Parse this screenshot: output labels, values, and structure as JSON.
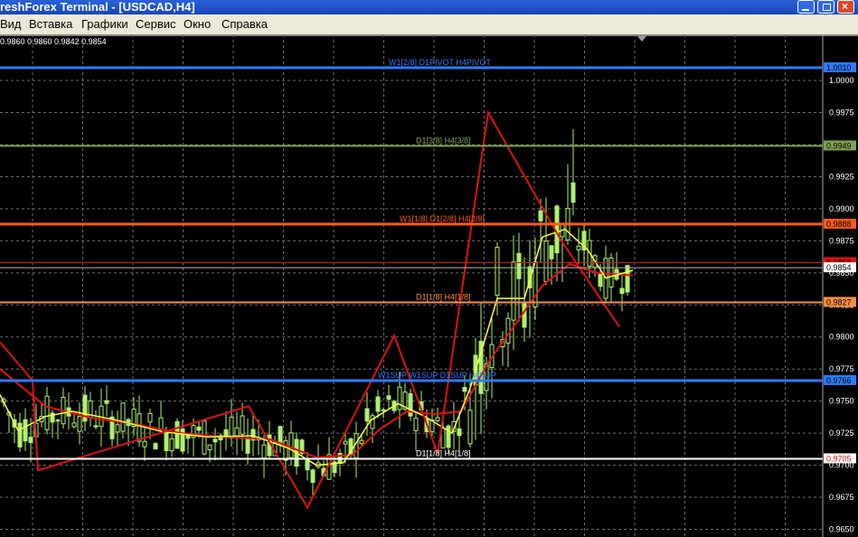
{
  "window": {
    "title": "reshForex Terminal - [USDCAD,H4]"
  },
  "menu": [
    "Вид",
    "Вставка",
    "Графики",
    "Сервис",
    "Окно",
    "Справка"
  ],
  "ohlc_text": "0.9860 0.9860 0.9842 0.9854",
  "colors": {
    "bg": "#000000",
    "grid": "#6b6b6b",
    "blue": "#2b7bff",
    "green": "#7fa050",
    "orange": "#ff5a1a",
    "red": "#e01010",
    "candle": "#b0f070",
    "yellow": "#ffff44"
  },
  "chart_data": {
    "type": "candlestick",
    "symbol": "USDCAD",
    "timeframe": "H4",
    "ylim": [
      0.9644,
      1.0036
    ],
    "price_ticks": [
      "1.0000",
      "0.9975",
      "0.9950",
      "0.9925",
      "0.9900",
      "0.9875",
      "0.9850",
      "0.9825",
      "0.9800",
      "0.9775",
      "0.9750",
      "0.9725",
      "0.9700",
      "0.9675",
      "0.9650"
    ],
    "current_price": "0.9854",
    "levels": [
      {
        "price": 1.001,
        "label": "W1[2/8] D1PIVOT H4PIVOT",
        "tag": "1.0010",
        "color": "#2b7bff",
        "width": 3
      },
      {
        "price": 0.9949,
        "label": "D1[3/8] H4[3/8]",
        "tag": "0.9949",
        "color": "#7fa050",
        "width": 2
      },
      {
        "price": 0.9888,
        "label": "W1[1/8] D1[2/8] H4[2/8]",
        "tag": "0.9888",
        "color": "#ff5a1a",
        "width": 3
      },
      {
        "price": 0.9858,
        "label": "",
        "tag": "0.9858",
        "color": "#e01010",
        "width": 1
      },
      {
        "price": 0.9827,
        "label": "D1[1/8] H4[1/8]",
        "tag": "0.9827",
        "color": "#ff8c40",
        "width": 2
      },
      {
        "price": 0.9766,
        "label": "W1SUP W1SUP D1SUP H4SUP",
        "tag": "0.9766",
        "color": "#2b7bff",
        "width": 3
      },
      {
        "price": 0.9705,
        "label": "D1[1/8] H4[1/8]",
        "tag": "0.9705",
        "color": "#ffffff",
        "width": 2
      }
    ],
    "zigzag": [
      [
        0,
        0.9796
      ],
      [
        36,
        0.9766
      ],
      [
        42,
        0.9696
      ],
      [
        275,
        0.9746
      ],
      [
        340,
        0.9667
      ],
      [
        436,
        0.9801
      ],
      [
        484,
        0.9709
      ],
      [
        540,
        0.9975
      ],
      [
        620,
        0.9876
      ],
      [
        685,
        0.9808
      ]
    ],
    "ma_yellow": [
      [
        0,
        0.9755
      ],
      [
        20,
        0.9727
      ],
      [
        50,
        0.9738
      ],
      [
        80,
        0.9742
      ],
      [
        130,
        0.9735
      ],
      [
        180,
        0.9726
      ],
      [
        230,
        0.9722
      ],
      [
        280,
        0.9723
      ],
      [
        320,
        0.9713
      ],
      [
        350,
        0.97
      ],
      [
        380,
        0.9702
      ],
      [
        410,
        0.9735
      ],
      [
        440,
        0.9748
      ],
      [
        470,
        0.9738
      ],
      [
        500,
        0.9725
      ],
      [
        520,
        0.976
      ],
      [
        550,
        0.983
      ],
      [
        580,
        0.983
      ],
      [
        600,
        0.9878
      ],
      [
        625,
        0.9884
      ],
      [
        650,
        0.9868
      ],
      [
        670,
        0.9846
      ],
      [
        700,
        0.9852
      ]
    ],
    "ma_red": [
      [
        0,
        0.9775
      ],
      [
        50,
        0.9746
      ],
      [
        100,
        0.9737
      ],
      [
        150,
        0.9732
      ],
      [
        200,
        0.9725
      ],
      [
        250,
        0.9722
      ],
      [
        300,
        0.972
      ],
      [
        350,
        0.9706
      ],
      [
        390,
        0.9708
      ],
      [
        420,
        0.9728
      ],
      [
        450,
        0.9742
      ],
      [
        480,
        0.974
      ],
      [
        510,
        0.9742
      ],
      [
        540,
        0.978
      ],
      [
        570,
        0.981
      ],
      [
        600,
        0.984
      ],
      [
        630,
        0.9857
      ],
      [
        660,
        0.985
      ],
      [
        700,
        0.9848
      ]
    ]
  }
}
